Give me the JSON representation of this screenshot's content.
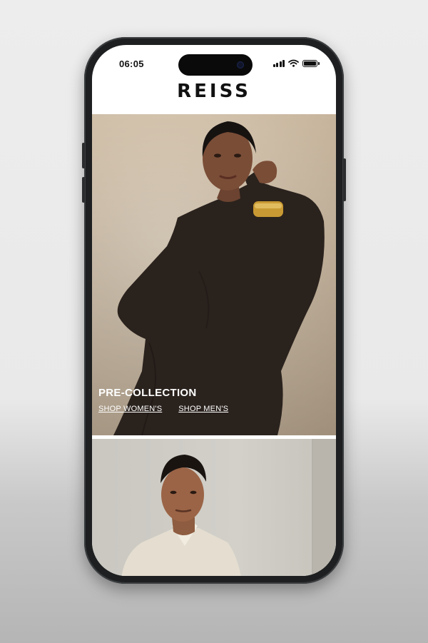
{
  "status_bar": {
    "time": "06:05"
  },
  "header": {
    "brand": "REISS"
  },
  "hero": {
    "title": "PRE-COLLECTION",
    "links": {
      "women": "SHOP WOMEN'S",
      "men": "SHOP MEN'S"
    }
  },
  "icons": [
    "signal-icon",
    "wifi-icon",
    "battery-icon"
  ],
  "colors": {
    "background": "#ececec",
    "phone_frame": "#1d1f20",
    "text_on_image": "#ffffff"
  }
}
